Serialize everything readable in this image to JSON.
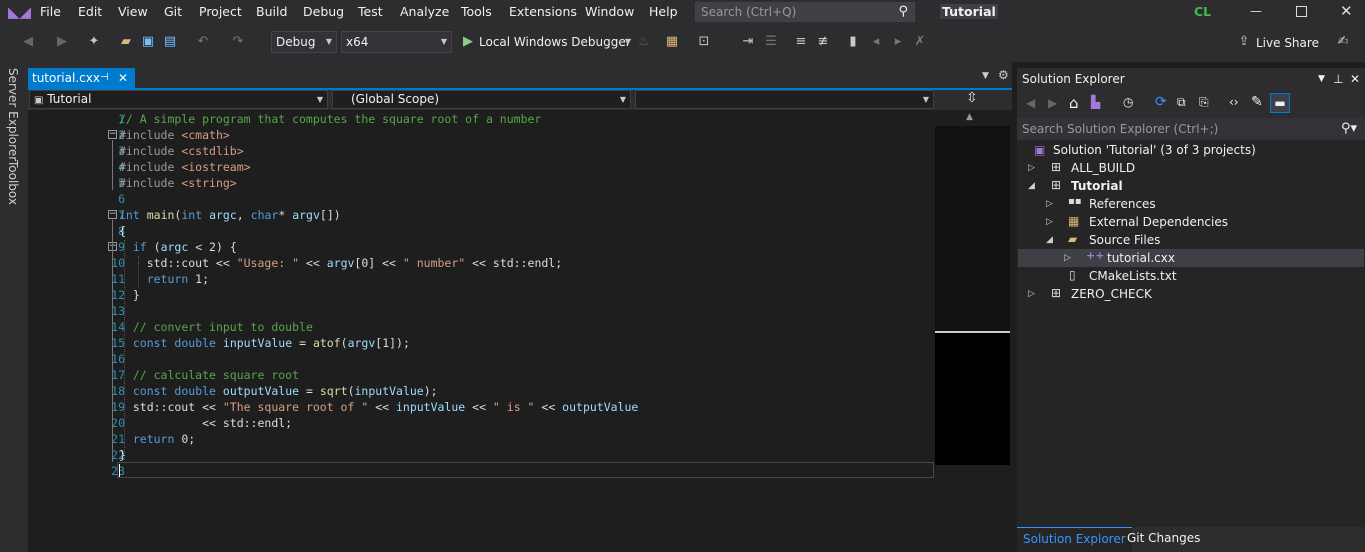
{
  "app": {
    "title": "Tutorial",
    "search_placeholder": "Search (Ctrl+Q)",
    "user_initials": "CL",
    "live_share": "Live Share",
    "accent": "#007acc"
  },
  "menu": [
    "File",
    "Edit",
    "View",
    "Git",
    "Project",
    "Build",
    "Debug",
    "Test",
    "Analyze",
    "Tools",
    "Extensions",
    "Window",
    "Help"
  ],
  "toolbar": {
    "config": "Debug",
    "platform": "x64",
    "debugger": "Local Windows Debugger"
  },
  "sidestrip": {
    "server_explorer": "Server Explorer",
    "toolbox": "Toolbox"
  },
  "editor": {
    "tab": "tutorial.cxx",
    "nav": {
      "project": "Tutorial",
      "scope": "(Global Scope)",
      "member": ""
    },
    "line_numbers": [
      "1",
      "2",
      "3",
      "4",
      "5",
      "6",
      "7",
      "8",
      "9",
      "10",
      "11",
      "12",
      "13",
      "14",
      "15",
      "16",
      "17",
      "18",
      "19",
      "20",
      "21",
      "22",
      "23"
    ]
  },
  "solution_explorer": {
    "title": "Solution Explorer",
    "search_placeholder": "Search Solution Explorer (Ctrl+;)",
    "solution": "Solution 'Tutorial' (3 of 3 projects)",
    "items": [
      "ALL_BUILD",
      "Tutorial",
      "References",
      "External Dependencies",
      "Source Files",
      "tutorial.cxx",
      "CMakeLists.txt",
      "ZERO_CHECK"
    ],
    "bottom_tabs": [
      "Solution Explorer",
      "Git Changes"
    ]
  }
}
